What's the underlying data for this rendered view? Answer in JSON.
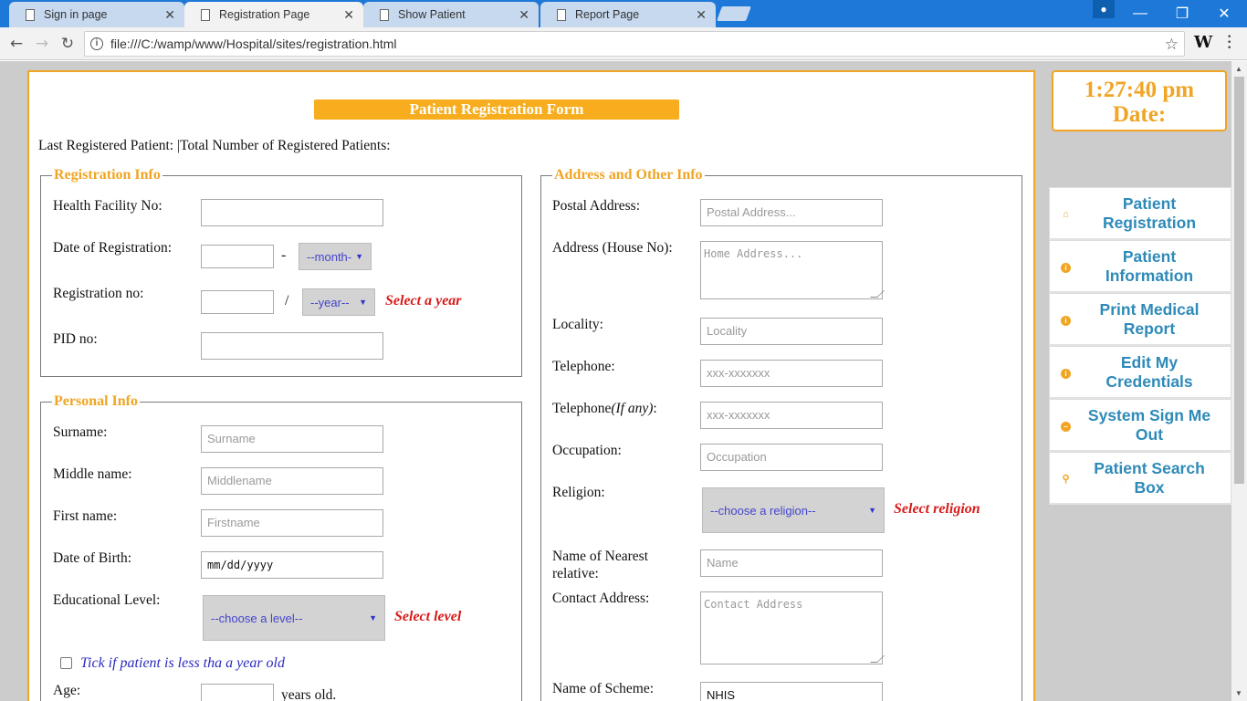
{
  "browser": {
    "tabs": [
      {
        "title": "Sign in page",
        "active": false
      },
      {
        "title": "Registration Page",
        "active": true
      },
      {
        "title": "Show Patient",
        "active": false
      },
      {
        "title": "Report Page",
        "active": false
      }
    ],
    "url": "file:///C:/wamp/www/Hospital/sites/registration.html",
    "extension_label": "W"
  },
  "form": {
    "title": "Patient Registration Form",
    "last_registered": "Last Registered Patient:  |Total Number of Registered Patients:",
    "registration_info": {
      "legend": "Registration Info",
      "health_facility_label": "Health Facility No:",
      "health_facility_value": "",
      "date_label": "Date of Registration:",
      "date_separator": "-",
      "month_select": "--month-",
      "regno_label": "Registration no:",
      "regno_separator": "/",
      "year_select": "--year--",
      "year_warning": "Select a year",
      "pid_label": "PID no:"
    },
    "personal_info": {
      "legend": "Personal Info",
      "surname_label": "Surname:",
      "surname_placeholder": "Surname",
      "middle_label": "Middle name:",
      "middle_placeholder": "Middlename",
      "first_label": "First name:",
      "first_placeholder": "Firstname",
      "dob_label": "Date of Birth:",
      "dob_value": "mm/dd/yyyy",
      "edu_label": "Educational Level:",
      "edu_select": "--choose a level--",
      "edu_warning": "Select level",
      "infant_checkbox_label": "Tick if patient is less tha a year old",
      "age_label": "Age:",
      "age_suffix": "years old."
    },
    "address_info": {
      "legend": "Address and Other Info",
      "postal_label": "Postal Address:",
      "postal_placeholder": "Postal Address...",
      "house_label": "Address (House No):",
      "house_placeholder": "Home Address...",
      "locality_label": "Locality:",
      "locality_placeholder": "Locality",
      "telephone_label": "Telephone:",
      "telephone_placeholder": "xxx-xxxxxxx",
      "telephone2_label": "Telephone",
      "telephone2_suffix": "(If any)",
      "telephone2_colon": ":",
      "telephone2_placeholder": "xxx-xxxxxxx",
      "occupation_label": "Occupation:",
      "occupation_placeholder": "Occupation",
      "religion_label": "Religion:",
      "religion_select": "--choose a religion--",
      "religion_warning": "Select religion",
      "relative_label": "Name of Nearest relative:",
      "relative_placeholder": "Name",
      "contact_label": "Contact Address:",
      "contact_placeholder": "Contact Address",
      "scheme_label": "Name of Scheme:",
      "scheme_value": "NHIS"
    }
  },
  "sidebar": {
    "clock_time": "1:27:40 pm",
    "clock_date_label": "Date:",
    "menu": [
      {
        "label": "Patient Registration",
        "icon": "home-icon"
      },
      {
        "label": "Patient Information",
        "icon": "info-icon"
      },
      {
        "label": "Print Medical Report",
        "icon": "info-icon"
      },
      {
        "label": "Edit My Credentials",
        "icon": "info-icon"
      },
      {
        "label": "System Sign Me Out",
        "icon": "minus-circle-icon"
      },
      {
        "label": "Patient Search Box",
        "icon": "search-icon"
      }
    ]
  },
  "colors": {
    "accent": "#f0a524",
    "menu_text": "#2e8ab8",
    "warning": "#d81b1b",
    "titlebar": "#1e78d7"
  }
}
